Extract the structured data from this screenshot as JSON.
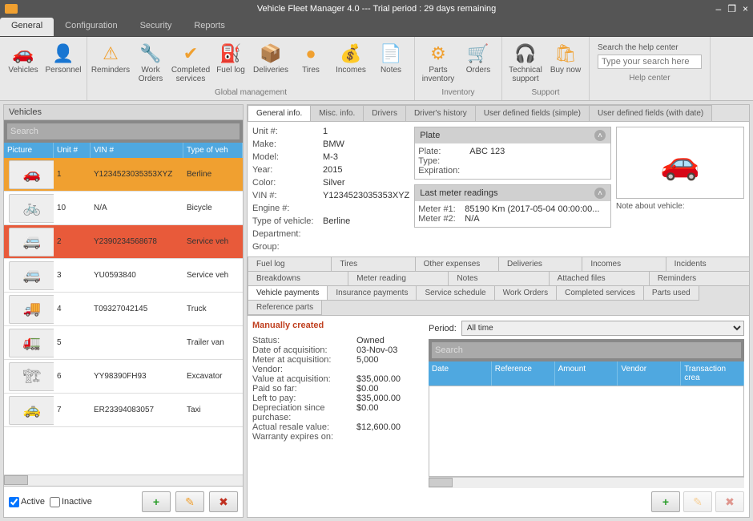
{
  "window": {
    "title": "Vehicle Fleet Manager 4.0 --- Trial period : 29 days remaining",
    "minimize": "–",
    "restore": "❐",
    "close": "×"
  },
  "menubar": [
    "General",
    "Configuration",
    "Security",
    "Reports"
  ],
  "ribbon": {
    "groups": [
      {
        "label": "",
        "items": [
          {
            "icon": "🚗",
            "label": "Vehicles"
          },
          {
            "icon": "👤",
            "label": "Personnel"
          }
        ]
      },
      {
        "label": "Global management",
        "items": [
          {
            "icon": "⚠",
            "label": "Reminders"
          },
          {
            "icon": "🔧",
            "label": "Work Orders"
          },
          {
            "icon": "✔",
            "label": "Completed services"
          },
          {
            "icon": "⛽",
            "label": "Fuel log"
          },
          {
            "icon": "📦",
            "label": "Deliveries"
          },
          {
            "icon": "●",
            "label": "Tires"
          },
          {
            "icon": "💰",
            "label": "Incomes"
          },
          {
            "icon": "📄",
            "label": "Notes"
          }
        ]
      },
      {
        "label": "Inventory",
        "items": [
          {
            "icon": "⚙",
            "label": "Parts inventory"
          },
          {
            "icon": "🛒",
            "label": "Orders"
          }
        ]
      },
      {
        "label": "Support",
        "items": [
          {
            "icon": "🎧",
            "label": "Technical support"
          },
          {
            "icon": "🛍",
            "label": "Buy now"
          }
        ]
      }
    ],
    "search": {
      "label": "Search the help center",
      "placeholder": "Type your search here"
    }
  },
  "leftPanel": {
    "title": "Vehicles",
    "searchPlaceholder": "Search",
    "columns": [
      "Picture",
      "Unit #",
      "VIN #",
      "Type of veh"
    ],
    "rows": [
      {
        "unit": "1",
        "vin": "Y1234523035353XYZ",
        "type": "Berline",
        "state": "hl",
        "thumb": "🚗"
      },
      {
        "unit": "10",
        "vin": "N/A",
        "type": "Bicycle",
        "state": "",
        "thumb": "🚲"
      },
      {
        "unit": "2",
        "vin": "Y2390234568678",
        "type": "Service veh",
        "state": "sel",
        "thumb": "🚐"
      },
      {
        "unit": "3",
        "vin": "YU0593840",
        "type": "Service veh",
        "state": "",
        "thumb": "🚐"
      },
      {
        "unit": "4",
        "vin": "T09327042145",
        "type": "Truck",
        "state": "",
        "thumb": "🚚"
      },
      {
        "unit": "5",
        "vin": "",
        "type": "Trailer van",
        "state": "",
        "thumb": "🚛"
      },
      {
        "unit": "6",
        "vin": "YY98390FH93",
        "type": "Excavator",
        "state": "",
        "thumb": "🏗"
      },
      {
        "unit": "7",
        "vin": "ER23394083057",
        "type": "Taxi",
        "state": "",
        "thumb": "🚕"
      }
    ],
    "activeLabel": "Active",
    "inactiveLabel": "Inactive",
    "add": "+",
    "edit": "✎",
    "delete": "✖"
  },
  "topTabs": [
    "General info.",
    "Misc. info.",
    "Drivers",
    "Driver's history",
    "User defined fields (simple)",
    "User defined fields (with date)"
  ],
  "generalInfo": {
    "kv": [
      {
        "k": "Unit #:",
        "v": "1"
      },
      {
        "k": "Make:",
        "v": "BMW"
      },
      {
        "k": "Model:",
        "v": "M-3"
      },
      {
        "k": "Year:",
        "v": "2015"
      },
      {
        "k": "Color:",
        "v": "Silver"
      },
      {
        "k": "VIN #:",
        "v": "Y1234523035353XYZ"
      },
      {
        "k": "Engine #:",
        "v": ""
      },
      {
        "k": "Type of vehicle:",
        "v": "Berline"
      },
      {
        "k": "Department:",
        "v": ""
      },
      {
        "k": "Group:",
        "v": ""
      }
    ],
    "plateCard": {
      "title": "Plate",
      "kv": [
        {
          "k": "Plate:",
          "v": "ABC 123"
        },
        {
          "k": "Type:",
          "v": ""
        },
        {
          "k": "Expiration:",
          "v": ""
        }
      ]
    },
    "meterCard": {
      "title": "Last meter readings",
      "kv": [
        {
          "k": "Meter #1:",
          "v": "85190 Km (2017-05-04 00:00:00..."
        },
        {
          "k": "Meter #2:",
          "v": "N/A"
        }
      ]
    },
    "noteLabel": "Note about vehicle:"
  },
  "subTabs": {
    "row1": [
      "Fuel log",
      "Tires",
      "Other expenses",
      "Deliveries",
      "Incomes",
      "Incidents"
    ],
    "row2": [
      "Breakdowns",
      "Meter reading",
      "Notes",
      "Attached files",
      "Reminders"
    ],
    "row3": [
      "Vehicle payments",
      "Insurance payments",
      "Service schedule",
      "Work Orders",
      "Completed services",
      "Parts used",
      "Reference parts"
    ]
  },
  "details": {
    "manually": "Manually created",
    "kv": [
      {
        "k": "Status:",
        "v": "Owned"
      },
      {
        "k": "Date of acquisition:",
        "v": "03-Nov-03"
      },
      {
        "k": "Meter at acquisition:",
        "v": "5,000"
      },
      {
        "k": "Vendor:",
        "v": ""
      },
      {
        "k": "Value at acquisition:",
        "v": "$35,000.00"
      },
      {
        "k": "Paid so far:",
        "v": "$0.00"
      },
      {
        "k": "Left to pay:",
        "v": "$35,000.00"
      },
      {
        "k": "Depreciation since purchase:",
        "v": "$0.00"
      },
      {
        "k": "Actual resale value:",
        "v": "$12,600.00"
      },
      {
        "k": "Warranty expires on:",
        "v": ""
      }
    ],
    "periodLabel": "Period:",
    "periodValue": "All time",
    "searchPlaceholder": "Search",
    "columns": [
      "Date",
      "Reference",
      "Amount",
      "Vendor",
      "Transaction crea"
    ],
    "add": "+",
    "edit": "✎",
    "delete": "✖"
  }
}
